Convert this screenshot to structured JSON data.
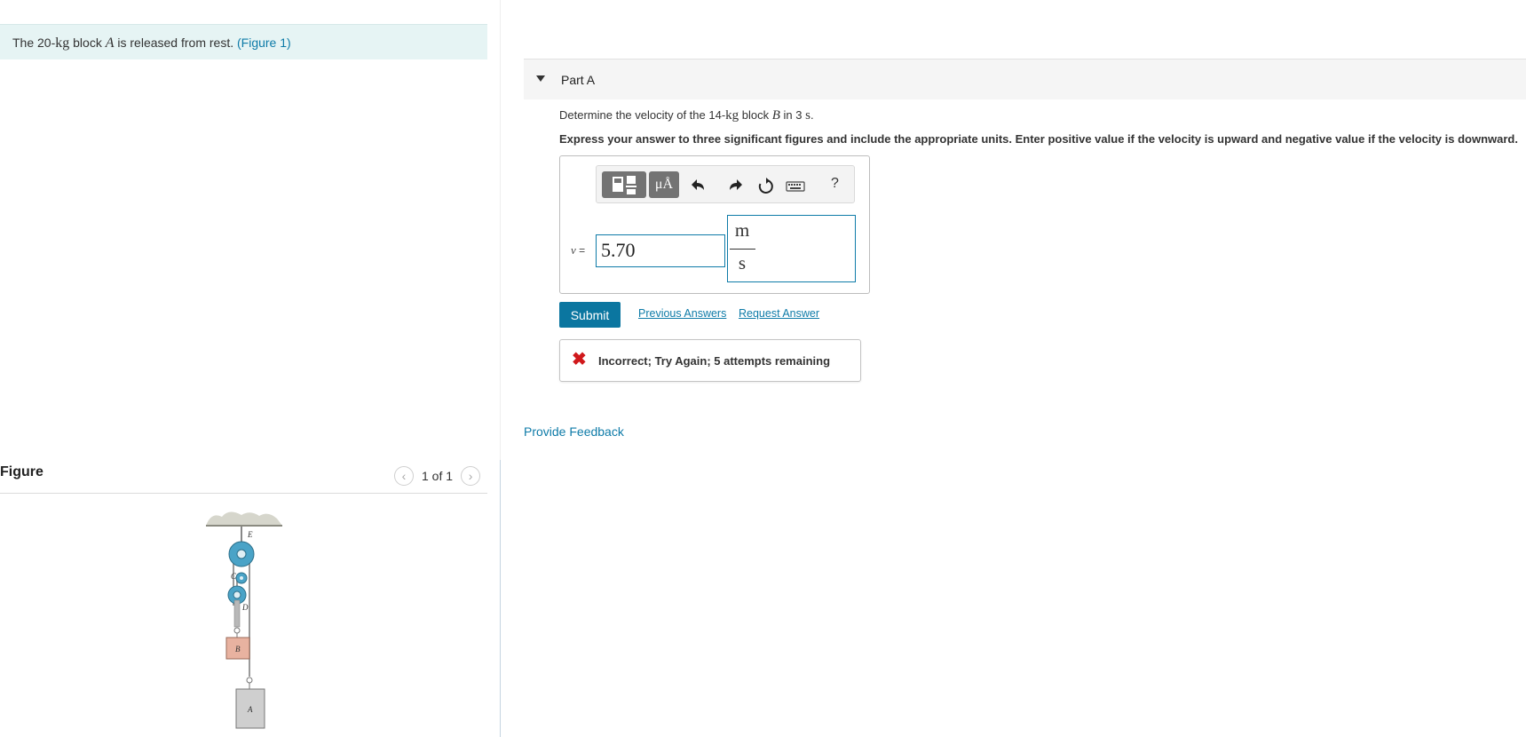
{
  "problem": {
    "prefix": "The 20-",
    "mass_unit": "kg",
    "middle": " block ",
    "block_var": "A",
    "suffix": " is released from rest. ",
    "figure_link": "(Figure 1)"
  },
  "figure": {
    "heading": "Figure",
    "page_indicator": "1 of 1",
    "labels": {
      "E": "E",
      "C": "C",
      "D": "D",
      "B": "B",
      "A": "A"
    }
  },
  "part": {
    "title": "Part A",
    "question": {
      "prefix": "Determine the velocity of the 14-",
      "mass_unit": "kg",
      "middle": " block ",
      "block_var": "B",
      "in_text": " in 3 ",
      "time_unit": "s",
      "end": "."
    },
    "instructions": "Express your answer to three significant figures and include the appropriate units. Enter positive value if the velocity is upward and negative value if the velocity is downward."
  },
  "answer": {
    "variable": "v",
    "equals": " =",
    "value": "5.70",
    "unit_numerator": "m",
    "unit_denominator": "s"
  },
  "toolbar": {
    "units_label": "μÅ",
    "help_label": "?",
    "icons": [
      "templates-icon",
      "units-icon",
      "undo-icon",
      "redo-icon",
      "reset-icon",
      "keyboard-icon",
      "help-icon"
    ]
  },
  "actions": {
    "submit_label": "Submit",
    "previous_answers_label": "Previous Answers",
    "request_answer_label": "Request Answer"
  },
  "feedback": {
    "icon": "✖",
    "message": "Incorrect; Try Again; 5 attempts remaining"
  },
  "provide_feedback_label": "Provide Feedback",
  "colors": {
    "accent": "#0b76a0",
    "link": "#0e7ba8",
    "error": "#d0181b",
    "banner_bg": "#e6f4f4",
    "pulley": "#4aa3c7",
    "block_b": "#e8b2a0",
    "block_a": "#cfcfcf"
  }
}
